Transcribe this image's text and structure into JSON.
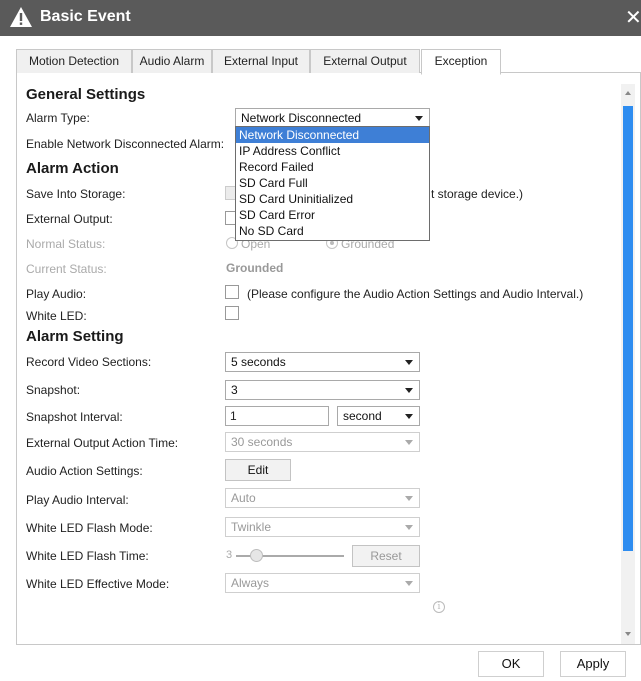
{
  "window": {
    "title": "Basic Event"
  },
  "tabs": [
    {
      "label": "Motion Detection"
    },
    {
      "label": "Audio Alarm"
    },
    {
      "label": "External Input"
    },
    {
      "label": "External Output"
    },
    {
      "label": "Exception"
    }
  ],
  "general": {
    "heading": "General Settings",
    "alarm_type_label": "Alarm Type:",
    "alarm_type_value": "Network Disconnected",
    "enable_label": "Enable Network Disconnected Alarm:",
    "alarm_type_options": [
      "Network Disconnected",
      "IP Address Conflict",
      "Record Failed",
      "SD Card Full",
      "SD Card Uninitialized",
      "SD Card Error",
      "No SD Card"
    ]
  },
  "alarm_action": {
    "heading": "Alarm Action",
    "save_storage_label": "Save Into Storage:",
    "save_storage_note_tail": "t storage device.)",
    "external_output_label": "External Output:",
    "normal_status_label": "Normal Status:",
    "open_label": "Open",
    "grounded_label": "Grounded",
    "current_status_label": "Current Status:",
    "current_status_value": "Grounded",
    "play_audio_label": "Play Audio:",
    "play_audio_note": "(Please configure the Audio Action Settings and Audio Interval.)",
    "white_led_label": "White LED:"
  },
  "alarm_setting": {
    "heading": "Alarm Setting",
    "record_sections_label": "Record Video Sections:",
    "record_sections_value": "5 seconds",
    "snapshot_label": "Snapshot:",
    "snapshot_value": "3",
    "snapshot_interval_label": "Snapshot Interval:",
    "snapshot_interval_value": "1",
    "snapshot_interval_unit": "second",
    "ext_output_time_label": "External Output Action Time:",
    "ext_output_time_value": "30 seconds",
    "audio_action_label": "Audio Action Settings:",
    "edit_label": "Edit",
    "play_audio_interval_label": "Play Audio Interval:",
    "play_audio_interval_value": "Auto",
    "led_flash_mode_label": "White LED Flash Mode:",
    "led_flash_mode_value": "Twinkle",
    "led_flash_time_label": "White LED Flash Time:",
    "led_flash_time_value": "3",
    "reset_label": "Reset",
    "led_effective_label": "White LED Effective Mode:",
    "led_effective_value": "Always"
  },
  "footer": {
    "ok_label": "OK",
    "apply_label": "Apply"
  },
  "colors": {
    "titlebar": "#5a5a5a",
    "selection": "#3e7fd6",
    "scrollbar": "#2d8cf0"
  },
  "icons": {
    "title": "warning-triangle-icon",
    "close": "close-icon",
    "info": "info-icon"
  }
}
